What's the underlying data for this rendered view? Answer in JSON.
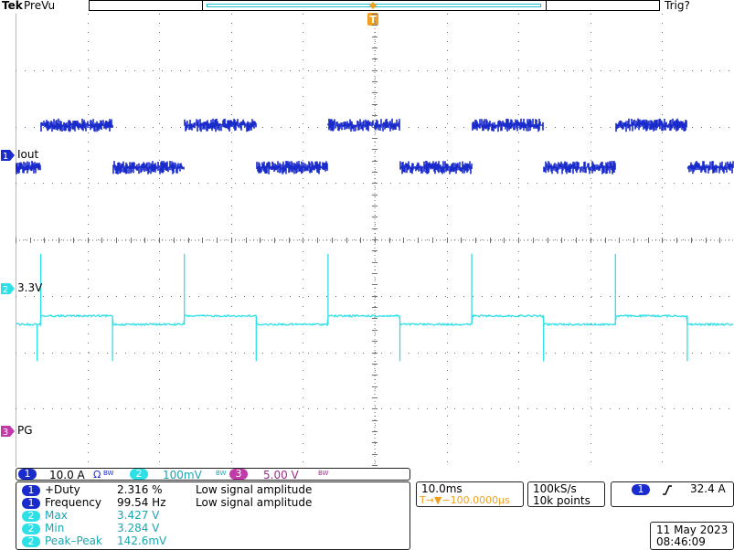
{
  "header": {
    "brand": "Tek",
    "acquisition_mode": "PreVu",
    "trigger_status": "Trig?",
    "trigger_marker_letter": "T"
  },
  "colors": {
    "ch1": "#1a2bcc",
    "ch2": "#2ee0e6",
    "ch3": "#c03aa8",
    "trigger": "#f0a020",
    "grid": "#707070"
  },
  "channels": [
    {
      "number": "1",
      "label": "Iout"
    },
    {
      "number": "2",
      "label": "3.3V"
    },
    {
      "number": "3",
      "label": "PG"
    }
  ],
  "settings": {
    "ch1": {
      "number": "1",
      "scale": "10.0 A",
      "coupling": "Ω",
      "bw": "BW"
    },
    "ch2": {
      "number": "2",
      "scale": "100mV",
      "bw": "BW"
    },
    "ch3": {
      "number": "3",
      "scale": "5.00 V",
      "bw": "BW"
    }
  },
  "measurements": [
    {
      "source": "1",
      "name": "+Duty",
      "value": "2.316 %",
      "note": "Low signal amplitude"
    },
    {
      "source": "1",
      "name": "Frequency",
      "value": "99.54 Hz",
      "note": "Low signal amplitude"
    },
    {
      "source": "2",
      "name": "Max",
      "value": "3.427 V",
      "note": ""
    },
    {
      "source": "2",
      "name": "Min",
      "value": "3.284 V",
      "note": ""
    },
    {
      "source": "2",
      "name": "Peak–Peak",
      "value": "142.6mV",
      "note": ""
    }
  ],
  "horizontal": {
    "scale": "10.0ms",
    "position": "T→▼−100.0000µs"
  },
  "sampling": {
    "rate": "100kS/s",
    "points": "10k points"
  },
  "trigger": {
    "source": "1",
    "slope": "rising",
    "level": "32.4 A"
  },
  "datetime": {
    "date": "11 May 2023",
    "time": "08:46:09"
  },
  "chart_data": {
    "type": "line",
    "title": "",
    "xlabel": "",
    "ylabel": "",
    "x_divisions": 10,
    "y_divisions": 8,
    "time_per_div_ms": 10,
    "series": [
      {
        "name": "Iout",
        "channel": 1,
        "kind": "square",
        "period_div": 2.0,
        "high_fraction": 0.5,
        "first_rise_div": 0.35,
        "high_div": 0.55,
        "low_div": -0.2,
        "noise_div": 0.12
      },
      {
        "name": "3.3V",
        "channel": 2,
        "kind": "steps_with_spikes",
        "period_div": 2.0,
        "first_rise_div": 0.35,
        "levels_div": [
          -0.6,
          -0.45
        ],
        "spike_up_div": 0.65,
        "spike_down_div": -1.25
      },
      {
        "name": "PG",
        "channel": 3,
        "kind": "flat",
        "level_div": -1.0
      }
    ]
  }
}
